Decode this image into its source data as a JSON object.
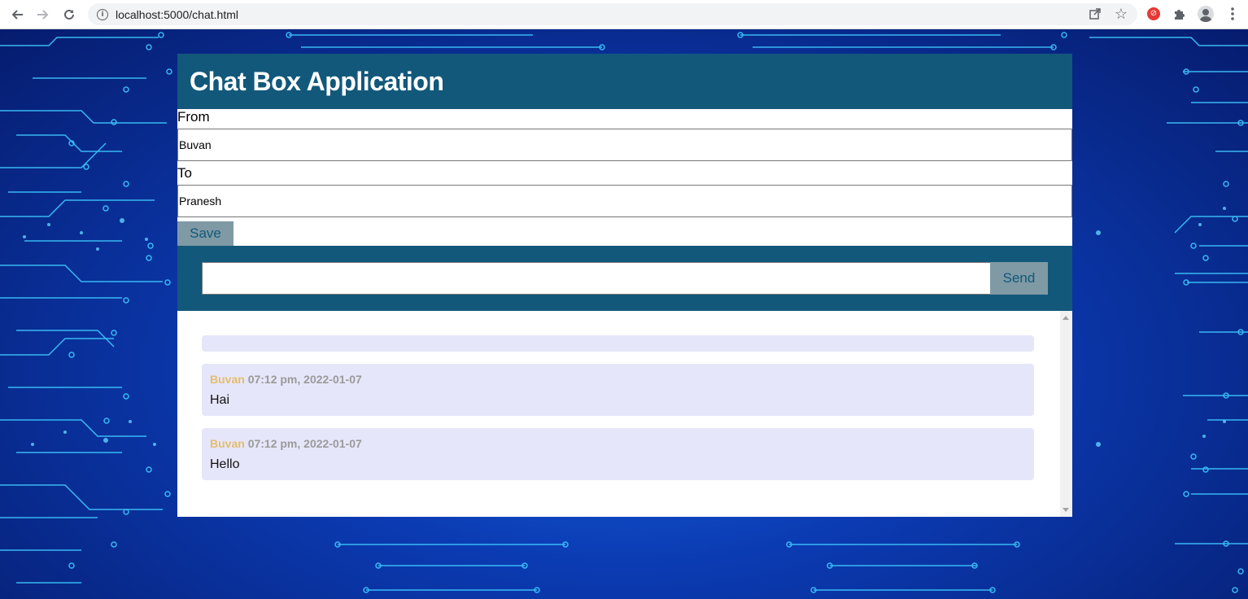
{
  "browser": {
    "url": "localhost:5000/chat.html",
    "nav_icons": [
      "back-arrow-icon",
      "forward-arrow-icon",
      "reload-icon"
    ],
    "toolbar_icons": [
      "share-icon",
      "star-icon",
      "extension-icon",
      "puzzle-icon",
      "profile-icon",
      "menu-icon"
    ]
  },
  "app": {
    "title": "Chat Box Application",
    "from_label": "From",
    "from_value": "Buvan",
    "to_label": "To",
    "to_value": "Pranesh",
    "save_label": "Save",
    "send_label": "Send",
    "message_input_value": ""
  },
  "messages": [
    {
      "author": "Buvan",
      "time": "07:12 pm, 2022-01-07",
      "text": "Hai"
    },
    {
      "author": "Buvan",
      "time": "07:12 pm, 2022-01-07",
      "text": "Hello"
    }
  ],
  "colors": {
    "header": "#12587a",
    "button": "#7f9aa5",
    "message_bg": "#e6e6fa",
    "author": "#e4bd6e",
    "timestamp": "#9a9a9a"
  }
}
